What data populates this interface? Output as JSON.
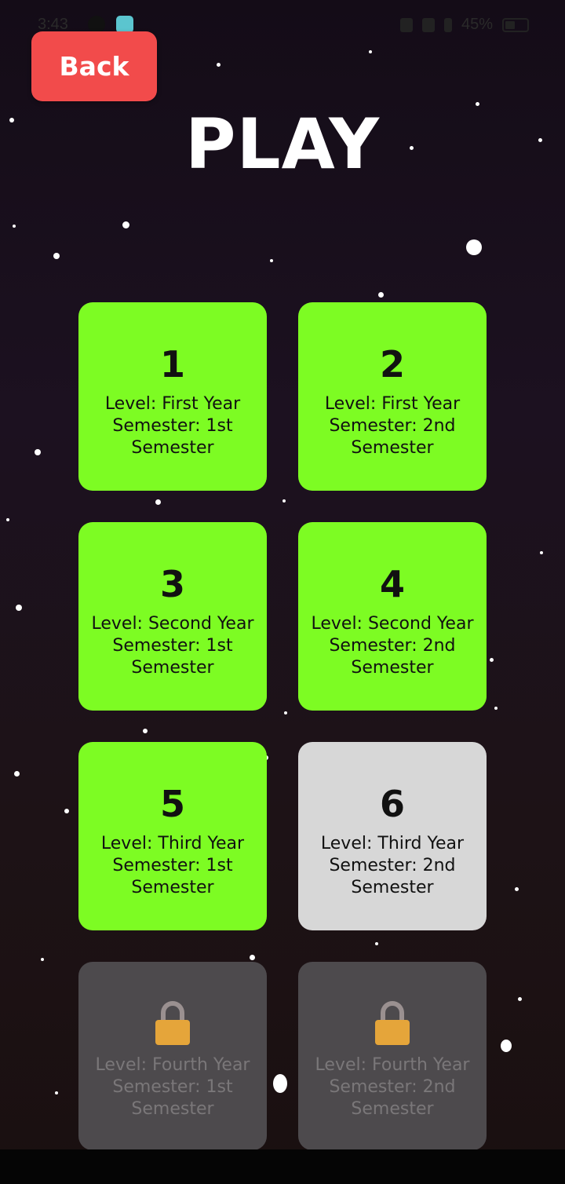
{
  "status_bar": {
    "time": "3:43",
    "battery": "45%",
    "battery_level": 0.45
  },
  "header": {
    "back_label": "Back",
    "title": "PLAY"
  },
  "levels": [
    {
      "number": "1",
      "text": "Level: First Year Semester: 1st Semester",
      "state": "unlocked"
    },
    {
      "number": "2",
      "text": "Level: First Year Semester: 2nd Semester",
      "state": "unlocked"
    },
    {
      "number": "3",
      "text": "Level: Second Year Semester: 1st Semester",
      "state": "unlocked"
    },
    {
      "number": "4",
      "text": "Level: Second Year Semester: 2nd Semester",
      "state": "unlocked"
    },
    {
      "number": "5",
      "text": "Level: Third Year Semester: 1st Semester",
      "state": "unlocked"
    },
    {
      "number": "6",
      "text": "Level: Third Year Semester: 2nd Semester",
      "state": "current"
    },
    {
      "number": "",
      "text": "Level: Fourth Year Semester: 1st Semester",
      "state": "locked",
      "icon": "lock-icon"
    },
    {
      "number": "",
      "text": "Level: Fourth Year Semester: 2nd Semester",
      "state": "locked",
      "icon": "lock-icon"
    }
  ],
  "colors": {
    "unlocked": "#7dfc23",
    "current": "#d7d7d7",
    "locked": "#4d4a4d",
    "back_button": "#f24b4b"
  }
}
